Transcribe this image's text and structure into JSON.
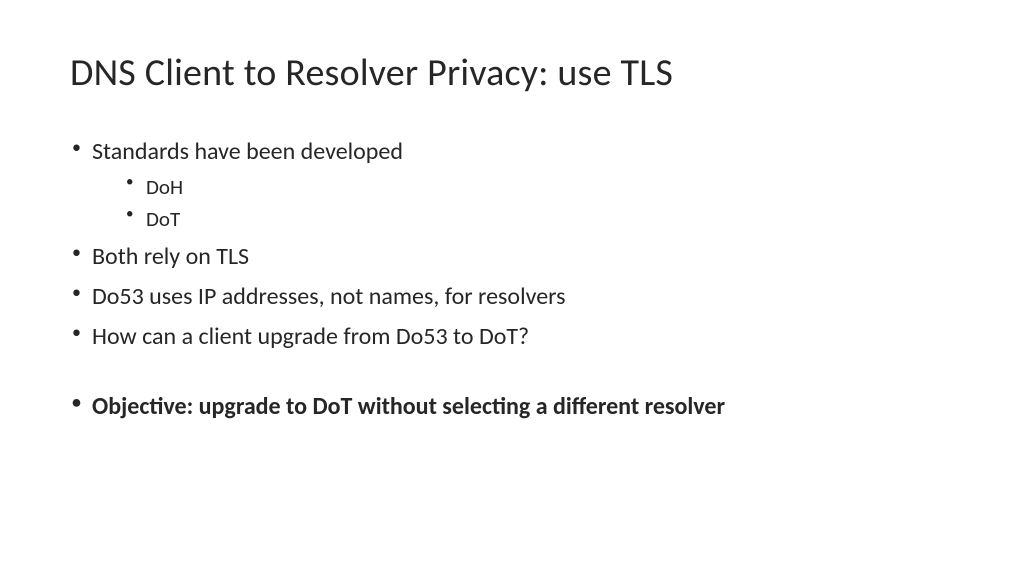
{
  "title": "DNS Client to Resolver Privacy: use TLS",
  "bullets": {
    "item1": "Standards have been developed",
    "sub1": "DoH",
    "sub2": "DoT",
    "item2": "Both rely on TLS",
    "item3": "Do53 uses IP addresses, not names, for resolvers",
    "item4": "How can a client upgrade from Do53 to DoT?",
    "item5": "Objective: upgrade to DoT without selecting a different resolver"
  }
}
